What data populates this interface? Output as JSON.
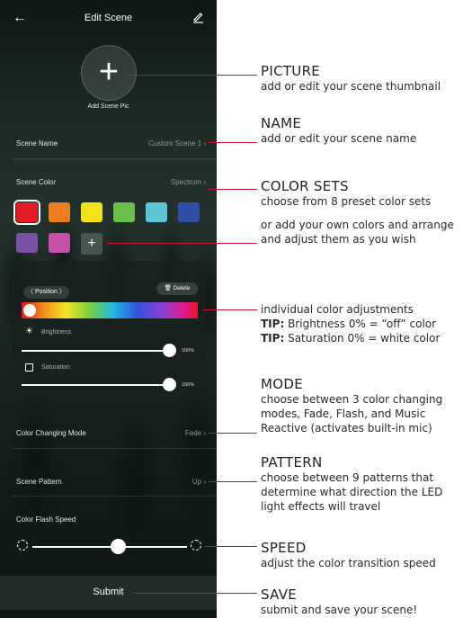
{
  "app": {
    "title": "Edit Scene",
    "scene_pic_label": "Add Scene Pic",
    "plus_glyph": "+",
    "name_row": {
      "label": "Scene Name",
      "value": "Custom Scene 1"
    },
    "color_row": {
      "label": "Scene Color",
      "value": "Spectrum"
    },
    "swatches": [
      {
        "color": "#e31b23",
        "selected": true
      },
      {
        "color": "#ef7d22"
      },
      {
        "color": "#f2e21b"
      },
      {
        "color": "#6cbf4a"
      },
      {
        "color": "#5cc6d8"
      },
      {
        "color": "#2d4fa5"
      },
      {
        "color": "#7b4fa6"
      },
      {
        "color": "#c451a7"
      }
    ],
    "adjust": {
      "position_label": "Position",
      "delete_label": "Delete",
      "brightness_label": "Brightness",
      "brightness_pct": "100%",
      "brightness_value": 1.0,
      "saturation_label": "Saturation",
      "saturation_pct": "100%",
      "saturation_value": 1.0
    },
    "mode_row": {
      "label": "Color Changing Mode",
      "value": "Fade"
    },
    "pattern_row": {
      "label": "Scene Pattern",
      "value": "Up"
    },
    "speed": {
      "label": "Color Flash Speed",
      "value": 0.55
    },
    "submit_label": "Submit"
  },
  "callouts": {
    "picture": {
      "title": "PICTURE",
      "desc": "add or edit your scene thumbnail"
    },
    "name": {
      "title": "NAME",
      "desc": "add or edit your scene name"
    },
    "color_sets": {
      "title": "COLOR SETS",
      "desc": "choose from 8 preset color sets",
      "desc2": "or add your own colors and arrange and adjust them as you wish"
    },
    "adjust": {
      "desc": "individual color adjustments",
      "tip_label": "TIP:",
      "tip1": "Brightness 0% = “off” color",
      "tip2": "Saturation 0% = white color"
    },
    "mode": {
      "title": "MODE",
      "desc": "choose between 3 color changing modes, Fade, Flash, and Music Reactive (activates built-in mic)"
    },
    "pattern": {
      "title": "PATTERN",
      "desc": "choose  between 9 patterns that determine what direction the LED light effects will travel"
    },
    "speed": {
      "title": "SPEED",
      "desc": "adjust the color transition speed"
    },
    "save": {
      "title": "SAVE",
      "desc": "submit and save your scene!"
    }
  },
  "colors": {
    "callout_line": "#c8102e"
  }
}
